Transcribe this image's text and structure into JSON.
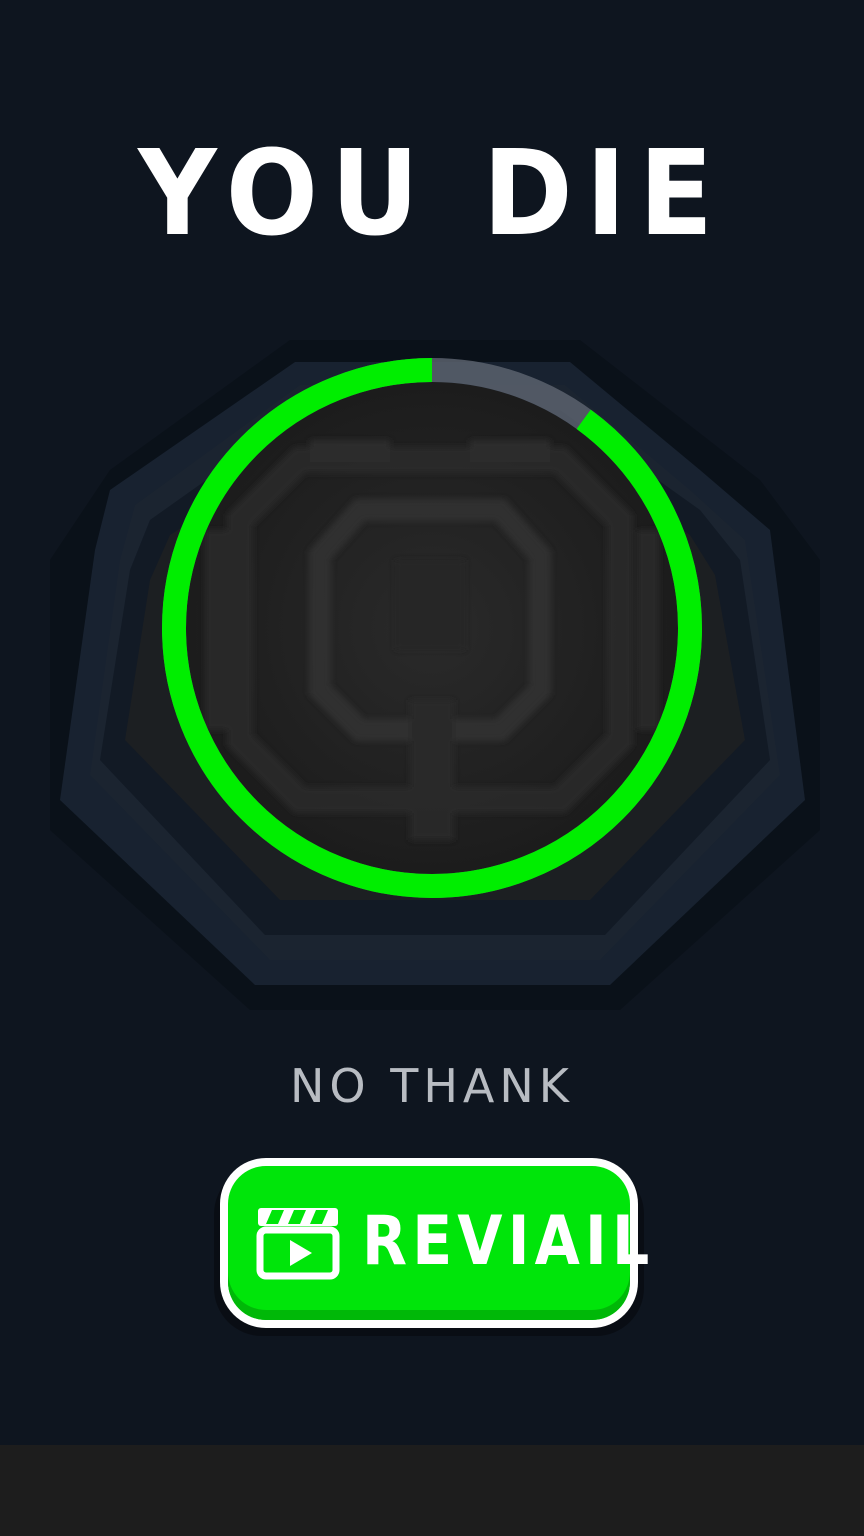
{
  "title": "YOU DIE",
  "countdown": {
    "remaining_fraction": 0.9,
    "ring_color": "#00ee00",
    "track_color": "#5a626d"
  },
  "skip_label": "NO THANK",
  "revive_button": {
    "label": "REVIAIL",
    "icon": "video-clapper-icon",
    "color": "#00e50a"
  },
  "colors": {
    "background": "#0e151f",
    "bottom_bar": "#1d1d1d"
  }
}
